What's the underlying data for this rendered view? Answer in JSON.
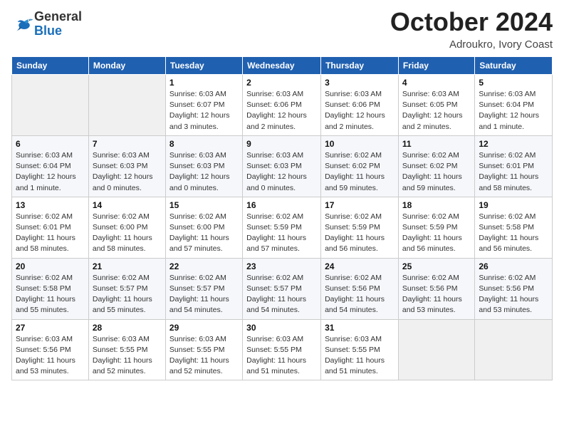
{
  "logo": {
    "general": "General",
    "blue": "Blue"
  },
  "header": {
    "month": "October 2024",
    "location": "Adroukro, Ivory Coast"
  },
  "weekdays": [
    "Sunday",
    "Monday",
    "Tuesday",
    "Wednesday",
    "Thursday",
    "Friday",
    "Saturday"
  ],
  "weeks": [
    [
      null,
      null,
      {
        "day": "1",
        "sunrise": "Sunrise: 6:03 AM",
        "sunset": "Sunset: 6:07 PM",
        "daylight": "Daylight: 12 hours and 3 minutes."
      },
      {
        "day": "2",
        "sunrise": "Sunrise: 6:03 AM",
        "sunset": "Sunset: 6:06 PM",
        "daylight": "Daylight: 12 hours and 2 minutes."
      },
      {
        "day": "3",
        "sunrise": "Sunrise: 6:03 AM",
        "sunset": "Sunset: 6:06 PM",
        "daylight": "Daylight: 12 hours and 2 minutes."
      },
      {
        "day": "4",
        "sunrise": "Sunrise: 6:03 AM",
        "sunset": "Sunset: 6:05 PM",
        "daylight": "Daylight: 12 hours and 2 minutes."
      },
      {
        "day": "5",
        "sunrise": "Sunrise: 6:03 AM",
        "sunset": "Sunset: 6:04 PM",
        "daylight": "Daylight: 12 hours and 1 minute."
      }
    ],
    [
      {
        "day": "6",
        "sunrise": "Sunrise: 6:03 AM",
        "sunset": "Sunset: 6:04 PM",
        "daylight": "Daylight: 12 hours and 1 minute."
      },
      {
        "day": "7",
        "sunrise": "Sunrise: 6:03 AM",
        "sunset": "Sunset: 6:03 PM",
        "daylight": "Daylight: 12 hours and 0 minutes."
      },
      {
        "day": "8",
        "sunrise": "Sunrise: 6:03 AM",
        "sunset": "Sunset: 6:03 PM",
        "daylight": "Daylight: 12 hours and 0 minutes."
      },
      {
        "day": "9",
        "sunrise": "Sunrise: 6:03 AM",
        "sunset": "Sunset: 6:03 PM",
        "daylight": "Daylight: 12 hours and 0 minutes."
      },
      {
        "day": "10",
        "sunrise": "Sunrise: 6:02 AM",
        "sunset": "Sunset: 6:02 PM",
        "daylight": "Daylight: 11 hours and 59 minutes."
      },
      {
        "day": "11",
        "sunrise": "Sunrise: 6:02 AM",
        "sunset": "Sunset: 6:02 PM",
        "daylight": "Daylight: 11 hours and 59 minutes."
      },
      {
        "day": "12",
        "sunrise": "Sunrise: 6:02 AM",
        "sunset": "Sunset: 6:01 PM",
        "daylight": "Daylight: 11 hours and 58 minutes."
      }
    ],
    [
      {
        "day": "13",
        "sunrise": "Sunrise: 6:02 AM",
        "sunset": "Sunset: 6:01 PM",
        "daylight": "Daylight: 11 hours and 58 minutes."
      },
      {
        "day": "14",
        "sunrise": "Sunrise: 6:02 AM",
        "sunset": "Sunset: 6:00 PM",
        "daylight": "Daylight: 11 hours and 58 minutes."
      },
      {
        "day": "15",
        "sunrise": "Sunrise: 6:02 AM",
        "sunset": "Sunset: 6:00 PM",
        "daylight": "Daylight: 11 hours and 57 minutes."
      },
      {
        "day": "16",
        "sunrise": "Sunrise: 6:02 AM",
        "sunset": "Sunset: 5:59 PM",
        "daylight": "Daylight: 11 hours and 57 minutes."
      },
      {
        "day": "17",
        "sunrise": "Sunrise: 6:02 AM",
        "sunset": "Sunset: 5:59 PM",
        "daylight": "Daylight: 11 hours and 56 minutes."
      },
      {
        "day": "18",
        "sunrise": "Sunrise: 6:02 AM",
        "sunset": "Sunset: 5:59 PM",
        "daylight": "Daylight: 11 hours and 56 minutes."
      },
      {
        "day": "19",
        "sunrise": "Sunrise: 6:02 AM",
        "sunset": "Sunset: 5:58 PM",
        "daylight": "Daylight: 11 hours and 56 minutes."
      }
    ],
    [
      {
        "day": "20",
        "sunrise": "Sunrise: 6:02 AM",
        "sunset": "Sunset: 5:58 PM",
        "daylight": "Daylight: 11 hours and 55 minutes."
      },
      {
        "day": "21",
        "sunrise": "Sunrise: 6:02 AM",
        "sunset": "Sunset: 5:57 PM",
        "daylight": "Daylight: 11 hours and 55 minutes."
      },
      {
        "day": "22",
        "sunrise": "Sunrise: 6:02 AM",
        "sunset": "Sunset: 5:57 PM",
        "daylight": "Daylight: 11 hours and 54 minutes."
      },
      {
        "day": "23",
        "sunrise": "Sunrise: 6:02 AM",
        "sunset": "Sunset: 5:57 PM",
        "daylight": "Daylight: 11 hours and 54 minutes."
      },
      {
        "day": "24",
        "sunrise": "Sunrise: 6:02 AM",
        "sunset": "Sunset: 5:56 PM",
        "daylight": "Daylight: 11 hours and 54 minutes."
      },
      {
        "day": "25",
        "sunrise": "Sunrise: 6:02 AM",
        "sunset": "Sunset: 5:56 PM",
        "daylight": "Daylight: 11 hours and 53 minutes."
      },
      {
        "day": "26",
        "sunrise": "Sunrise: 6:02 AM",
        "sunset": "Sunset: 5:56 PM",
        "daylight": "Daylight: 11 hours and 53 minutes."
      }
    ],
    [
      {
        "day": "27",
        "sunrise": "Sunrise: 6:03 AM",
        "sunset": "Sunset: 5:56 PM",
        "daylight": "Daylight: 11 hours and 53 minutes."
      },
      {
        "day": "28",
        "sunrise": "Sunrise: 6:03 AM",
        "sunset": "Sunset: 5:55 PM",
        "daylight": "Daylight: 11 hours and 52 minutes."
      },
      {
        "day": "29",
        "sunrise": "Sunrise: 6:03 AM",
        "sunset": "Sunset: 5:55 PM",
        "daylight": "Daylight: 11 hours and 52 minutes."
      },
      {
        "day": "30",
        "sunrise": "Sunrise: 6:03 AM",
        "sunset": "Sunset: 5:55 PM",
        "daylight": "Daylight: 11 hours and 51 minutes."
      },
      {
        "day": "31",
        "sunrise": "Sunrise: 6:03 AM",
        "sunset": "Sunset: 5:55 PM",
        "daylight": "Daylight: 11 hours and 51 minutes."
      },
      null,
      null
    ]
  ]
}
